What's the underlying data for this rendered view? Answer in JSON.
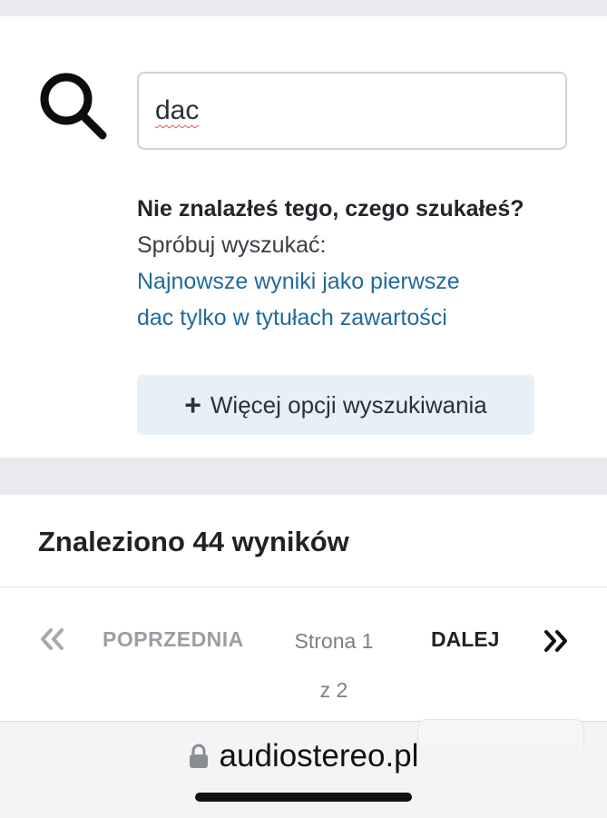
{
  "search": {
    "value": "dac"
  },
  "hint": {
    "bold_text": "Nie znalazłeś tego, czego szukałeś?",
    "text": "Spróbuj wyszukać:",
    "link_newest": "Najnowsze wyniki jako pierwsze",
    "link_titles": "dac tylko w tytułach zawartości"
  },
  "more_options": {
    "icon": "plus-icon",
    "label": "Więcej opcji wyszukiwania"
  },
  "results": {
    "title": "Znaleziono 44 wyników"
  },
  "pagination": {
    "first_icon": "double-chevron-left-icon",
    "prev_label": "POPRZEDNIA",
    "page_line1": "Strona 1",
    "page_line2": "z 2",
    "next_label": "DALEJ",
    "last_icon": "double-chevron-right-icon"
  },
  "browser": {
    "url": "audiostereo.pl",
    "lock_icon": "lock-icon"
  }
}
